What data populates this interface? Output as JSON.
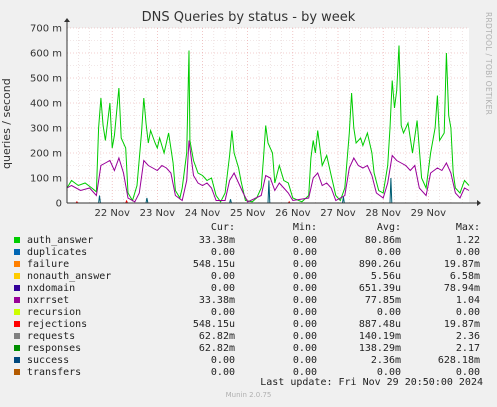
{
  "chart_data": {
    "type": "line",
    "title": "DNS Queries by status - by week",
    "ylabel": "queries / second",
    "ylim": [
      0,
      700
    ],
    "yticks": [
      0,
      100,
      200,
      300,
      400,
      500,
      600,
      700
    ],
    "ytick_labels": [
      "0",
      "100 m",
      "200 m",
      "300 m",
      "400 m",
      "500 m",
      "600 m",
      "700 m"
    ],
    "xtick_labels": [
      "22 Nov",
      "23 Nov",
      "24 Nov",
      "25 Nov",
      "26 Nov",
      "27 Nov",
      "28 Nov",
      "29 Nov"
    ],
    "x_start_day": 21.0,
    "x_end_day": 29.9,
    "grid": true,
    "series": [
      {
        "name": "auth_answer",
        "color": "#00cc00",
        "values": [
          [
            21.0,
            60
          ],
          [
            21.1,
            90
          ],
          [
            21.25,
            70
          ],
          [
            21.4,
            80
          ],
          [
            21.55,
            60
          ],
          [
            21.65,
            45
          ],
          [
            21.7,
            300
          ],
          [
            21.75,
            420
          ],
          [
            21.8,
            310
          ],
          [
            21.85,
            250
          ],
          [
            21.95,
            400
          ],
          [
            22.0,
            220
          ],
          [
            22.05,
            270
          ],
          [
            22.15,
            460
          ],
          [
            22.2,
            260
          ],
          [
            22.3,
            220
          ],
          [
            22.35,
            40
          ],
          [
            22.45,
            10
          ],
          [
            22.55,
            70
          ],
          [
            22.65,
            280
          ],
          [
            22.7,
            420
          ],
          [
            22.75,
            320
          ],
          [
            22.8,
            240
          ],
          [
            22.85,
            290
          ],
          [
            22.95,
            240
          ],
          [
            23.0,
            220
          ],
          [
            23.05,
            260
          ],
          [
            23.15,
            200
          ],
          [
            23.25,
            280
          ],
          [
            23.35,
            160
          ],
          [
            23.4,
            50
          ],
          [
            23.5,
            20
          ],
          [
            23.55,
            60
          ],
          [
            23.65,
            200
          ],
          [
            23.7,
            610
          ],
          [
            23.72,
            250
          ],
          [
            23.8,
            170
          ],
          [
            23.9,
            120
          ],
          [
            24.0,
            110
          ],
          [
            24.05,
            100
          ],
          [
            24.1,
            90
          ],
          [
            24.2,
            100
          ],
          [
            24.3,
            30
          ],
          [
            24.4,
            5
          ],
          [
            24.5,
            40
          ],
          [
            24.6,
            190
          ],
          [
            24.65,
            290
          ],
          [
            24.7,
            200
          ],
          [
            24.8,
            140
          ],
          [
            24.85,
            90
          ],
          [
            24.95,
            10
          ],
          [
            25.1,
            5
          ],
          [
            25.2,
            20
          ],
          [
            25.3,
            60
          ],
          [
            25.35,
            180
          ],
          [
            25.4,
            310
          ],
          [
            25.45,
            240
          ],
          [
            25.55,
            200
          ],
          [
            25.6,
            80
          ],
          [
            25.7,
            150
          ],
          [
            25.8,
            90
          ],
          [
            25.9,
            80
          ],
          [
            26.0,
            20
          ],
          [
            26.2,
            5
          ],
          [
            26.35,
            30
          ],
          [
            26.4,
            180
          ],
          [
            26.45,
            250
          ],
          [
            26.5,
            200
          ],
          [
            26.55,
            290
          ],
          [
            26.65,
            150
          ],
          [
            26.75,
            190
          ],
          [
            26.85,
            110
          ],
          [
            26.95,
            30
          ],
          [
            27.05,
            10
          ],
          [
            27.15,
            60
          ],
          [
            27.25,
            280
          ],
          [
            27.3,
            440
          ],
          [
            27.35,
            300
          ],
          [
            27.4,
            240
          ],
          [
            27.5,
            260
          ],
          [
            27.55,
            230
          ],
          [
            27.65,
            280
          ],
          [
            27.75,
            200
          ],
          [
            27.8,
            120
          ],
          [
            27.9,
            50
          ],
          [
            28.0,
            40
          ],
          [
            28.1,
            150
          ],
          [
            28.15,
            300
          ],
          [
            28.2,
            490
          ],
          [
            28.25,
            380
          ],
          [
            28.3,
            450
          ],
          [
            28.35,
            630
          ],
          [
            28.4,
            310
          ],
          [
            28.45,
            280
          ],
          [
            28.55,
            320
          ],
          [
            28.65,
            200
          ],
          [
            28.75,
            330
          ],
          [
            28.85,
            100
          ],
          [
            28.95,
            60
          ],
          [
            29.05,
            200
          ],
          [
            29.15,
            300
          ],
          [
            29.2,
            430
          ],
          [
            29.25,
            250
          ],
          [
            29.35,
            280
          ],
          [
            29.4,
            600
          ],
          [
            29.45,
            350
          ],
          [
            29.5,
            300
          ],
          [
            29.55,
            120
          ],
          [
            29.6,
            60
          ],
          [
            29.7,
            40
          ],
          [
            29.8,
            90
          ],
          [
            29.9,
            70
          ]
        ]
      },
      {
        "name": "nxrrset",
        "color": "#990099",
        "values": [
          [
            21.0,
            60
          ],
          [
            21.1,
            70
          ],
          [
            21.3,
            50
          ],
          [
            21.5,
            60
          ],
          [
            21.65,
            30
          ],
          [
            21.75,
            150
          ],
          [
            21.85,
            160
          ],
          [
            21.95,
            170
          ],
          [
            22.05,
            130
          ],
          [
            22.15,
            180
          ],
          [
            22.25,
            120
          ],
          [
            22.35,
            20
          ],
          [
            22.5,
            5
          ],
          [
            22.6,
            40
          ],
          [
            22.7,
            170
          ],
          [
            22.8,
            150
          ],
          [
            22.9,
            140
          ],
          [
            23.0,
            130
          ],
          [
            23.1,
            150
          ],
          [
            23.2,
            140
          ],
          [
            23.3,
            120
          ],
          [
            23.4,
            30
          ],
          [
            23.55,
            10
          ],
          [
            23.65,
            90
          ],
          [
            23.7,
            250
          ],
          [
            23.8,
            110
          ],
          [
            23.9,
            80
          ],
          [
            24.0,
            70
          ],
          [
            24.1,
            80
          ],
          [
            24.2,
            60
          ],
          [
            24.3,
            10
          ],
          [
            24.5,
            10
          ],
          [
            24.6,
            90
          ],
          [
            24.7,
            120
          ],
          [
            24.8,
            80
          ],
          [
            24.9,
            40
          ],
          [
            25.0,
            5
          ],
          [
            25.3,
            30
          ],
          [
            25.4,
            110
          ],
          [
            25.5,
            100
          ],
          [
            25.6,
            50
          ],
          [
            25.7,
            80
          ],
          [
            25.8,
            60
          ],
          [
            25.9,
            40
          ],
          [
            26.0,
            10
          ],
          [
            26.35,
            20
          ],
          [
            26.45,
            100
          ],
          [
            26.55,
            120
          ],
          [
            26.65,
            70
          ],
          [
            26.75,
            80
          ],
          [
            26.85,
            60
          ],
          [
            26.95,
            10
          ],
          [
            27.15,
            30
          ],
          [
            27.25,
            140
          ],
          [
            27.35,
            180
          ],
          [
            27.45,
            150
          ],
          [
            27.55,
            140
          ],
          [
            27.65,
            150
          ],
          [
            27.75,
            110
          ],
          [
            27.85,
            40
          ],
          [
            28.0,
            20
          ],
          [
            28.1,
            80
          ],
          [
            28.2,
            190
          ],
          [
            28.3,
            170
          ],
          [
            28.4,
            160
          ],
          [
            28.5,
            150
          ],
          [
            28.6,
            130
          ],
          [
            28.7,
            150
          ],
          [
            28.8,
            60
          ],
          [
            28.95,
            30
          ],
          [
            29.05,
            120
          ],
          [
            29.2,
            140
          ],
          [
            29.3,
            130
          ],
          [
            29.4,
            160
          ],
          [
            29.5,
            120
          ],
          [
            29.6,
            40
          ],
          [
            29.7,
            20
          ],
          [
            29.8,
            60
          ],
          [
            29.9,
            50
          ]
        ]
      },
      {
        "name": "success",
        "color": "#005d73",
        "values": [
          [
            21.0,
            0
          ],
          [
            21.7,
            0
          ],
          [
            21.72,
            30
          ],
          [
            21.74,
            0
          ],
          [
            22.75,
            0
          ],
          [
            22.77,
            20
          ],
          [
            22.79,
            0
          ],
          [
            24.6,
            0
          ],
          [
            24.62,
            15
          ],
          [
            24.64,
            0
          ],
          [
            25.45,
            0
          ],
          [
            25.47,
            90
          ],
          [
            25.49,
            0
          ],
          [
            27.1,
            0
          ],
          [
            27.12,
            25
          ],
          [
            27.14,
            0
          ],
          [
            28.15,
            0
          ],
          [
            28.17,
            100
          ],
          [
            28.19,
            0
          ],
          [
            29.9,
            0
          ]
        ]
      },
      {
        "name": "rejections",
        "color": "#ee0000",
        "values": [
          [
            21.0,
            0
          ],
          [
            21.2,
            0
          ],
          [
            21.22,
            5
          ],
          [
            21.24,
            0
          ],
          [
            22.3,
            0
          ],
          [
            22.32,
            8
          ],
          [
            22.34,
            0
          ],
          [
            25.9,
            0
          ],
          [
            25.92,
            5
          ],
          [
            25.94,
            0
          ],
          [
            29.9,
            0
          ]
        ]
      }
    ],
    "legend": {
      "headers": [
        "Cur:",
        "Min:",
        "Avg:",
        "Max:"
      ],
      "rows": [
        {
          "name": "auth_answer",
          "color": "#00cc00",
          "cur": "33.38m",
          "min": "0.00",
          "avg": "80.86m",
          "max": "1.22"
        },
        {
          "name": "duplicates",
          "color": "#0066b3",
          "cur": "0.00",
          "min": "0.00",
          "avg": "0.00",
          "max": "0.00"
        },
        {
          "name": "failure",
          "color": "#ff8000",
          "cur": "548.15u",
          "min": "0.00",
          "avg": "890.26u",
          "max": "19.87m"
        },
        {
          "name": "nonauth_answer",
          "color": "#ffcc00",
          "cur": "0.00",
          "min": "0.00",
          "avg": "5.56u",
          "max": "6.58m"
        },
        {
          "name": "nxdomain",
          "color": "#330099",
          "cur": "0.00",
          "min": "0.00",
          "avg": "651.39u",
          "max": "78.94m"
        },
        {
          "name": "nxrrset",
          "color": "#990099",
          "cur": "33.38m",
          "min": "0.00",
          "avg": "77.85m",
          "max": "1.04"
        },
        {
          "name": "recursion",
          "color": "#ccff00",
          "cur": "0.00",
          "min": "0.00",
          "avg": "0.00",
          "max": "0.00"
        },
        {
          "name": "rejections",
          "color": "#ff0000",
          "cur": "548.15u",
          "min": "0.00",
          "avg": "887.48u",
          "max": "19.87m"
        },
        {
          "name": "requests",
          "color": "#808080",
          "cur": "62.82m",
          "min": "0.00",
          "avg": "140.19m",
          "max": "2.36"
        },
        {
          "name": "responses",
          "color": "#008f00",
          "cur": "62.82m",
          "min": "0.00",
          "avg": "138.29m",
          "max": "2.17"
        },
        {
          "name": "success",
          "color": "#00487d",
          "cur": "0.00",
          "min": "0.00",
          "avg": "2.36m",
          "max": "628.18m"
        },
        {
          "name": "transfers",
          "color": "#b35a00",
          "cur": "0.00",
          "min": "0.00",
          "avg": "0.00",
          "max": "0.00"
        }
      ]
    }
  },
  "watermark": "RRDTOOL / TOBI OETIKER",
  "last_update": "Last update: Fri Nov 29 20:50:00 2024",
  "footer": "Munin 2.0.75"
}
